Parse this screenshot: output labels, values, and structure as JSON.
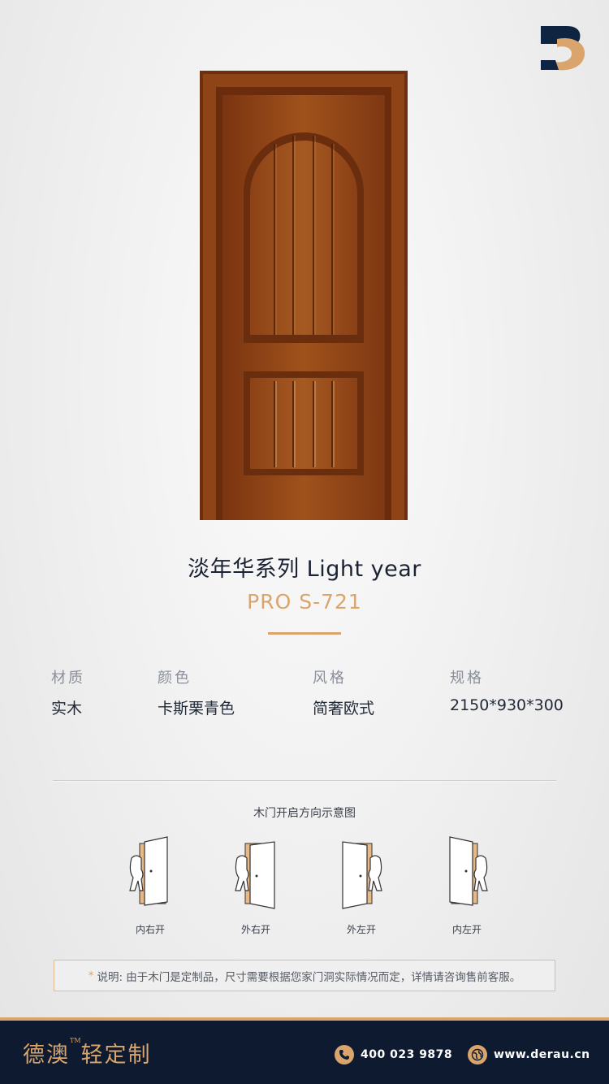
{
  "product": {
    "series_title": "淡年华系列  Light year",
    "model": "PRO S-721"
  },
  "specs": [
    {
      "label": "材质",
      "value": "实木"
    },
    {
      "label": "颜色",
      "value": "卡斯栗青色"
    },
    {
      "label": "风格",
      "value": "简奢欧式"
    },
    {
      "label": "规格",
      "value": "2150*930*300"
    }
  ],
  "diagram": {
    "title": "木门开启方向示意图",
    "options": [
      {
        "label": "内右开",
        "icon": "door-open-inward-right-icon"
      },
      {
        "label": "外右开",
        "icon": "door-open-outward-right-icon"
      },
      {
        "label": "外左开",
        "icon": "door-open-outward-left-icon"
      },
      {
        "label": "内左开",
        "icon": "door-open-inward-left-icon"
      }
    ]
  },
  "note": {
    "star": "*",
    "text": "说明: 由于木门是定制品，尺寸需要根据您家门洞实际情况而定，详情请咨询售前客服。"
  },
  "footer": {
    "brand": "德澳",
    "trademark": "TM",
    "brand_sub": "轻定制",
    "phone": "400 023 9878",
    "website": "www.derau.cn",
    "phone_icon": "phone-icon",
    "globe_icon": "globe-icon"
  },
  "colors": {
    "accent": "#d9a56c",
    "navy": "#0d1a2f",
    "wood": "#8a3f12"
  }
}
